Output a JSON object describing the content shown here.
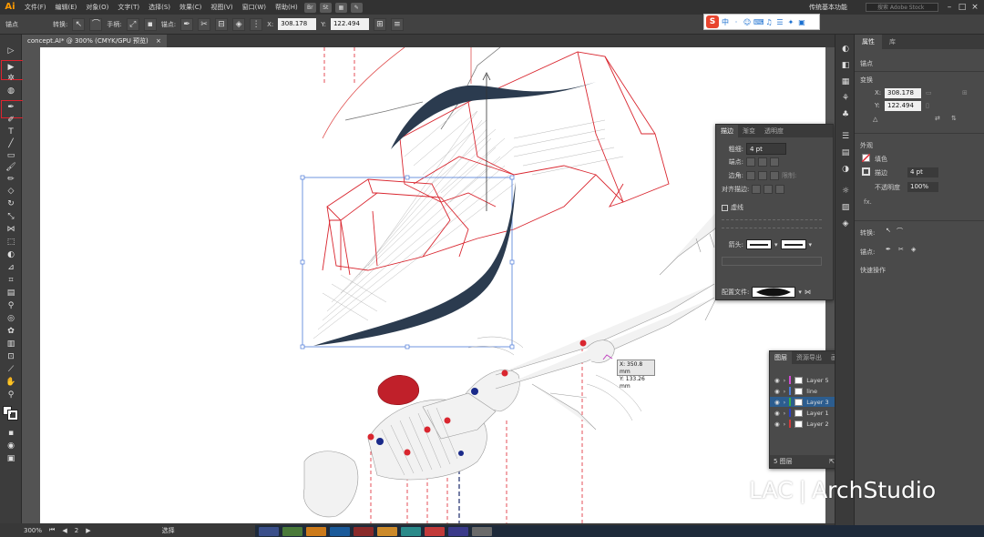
{
  "app": {
    "logo": "Ai",
    "workspace": "传统基本功能",
    "search_placeholder": "搜索 Adobe Stock"
  },
  "menu": [
    "文件(F)",
    "编辑(E)",
    "对象(O)",
    "文字(T)",
    "选择(S)",
    "效果(C)",
    "视图(V)",
    "窗口(W)",
    "帮助(H)"
  ],
  "bridge_icons": [
    "Br",
    "St"
  ],
  "control": {
    "selection_label": "锚点",
    "convert_label": "转换:",
    "handles_label": "手柄:",
    "anchors_label": "锚点:",
    "x_label": "X:",
    "x_value": "308.178",
    "y_label": "Y:",
    "y_value": "122.494"
  },
  "ime": {
    "logo": "S",
    "items": [
      "中",
      "·",
      "☺",
      "⌨",
      "♫",
      "☰",
      "✦",
      "▣"
    ]
  },
  "document": {
    "tab_title": "concept.AI* @ 300% (CMYK/GPU 预览)",
    "close": "×"
  },
  "status": {
    "zoom": "300%",
    "artboard_nav": "2",
    "tool": "选择"
  },
  "properties": {
    "tabs": [
      "属性",
      "库"
    ],
    "section_anchor": "锚点",
    "section_transform": "变换",
    "x_label": "X:",
    "x_value": "308.178",
    "y_label": "Y:",
    "y_value": "122.494",
    "angle_label": "△",
    "appearance": "外观",
    "fill": "填色",
    "stroke": "描边",
    "stroke_value": "4 pt",
    "opacity": "不透明度",
    "opacity_value": "100%",
    "convert": "转换:",
    "anchor_label": "锚点:",
    "quick_actions": "快速操作"
  },
  "stroke_panel": {
    "tabs": [
      "描边",
      "渐变",
      "透明度"
    ],
    "weight_label": "粗细:",
    "weight_value": "4 pt",
    "cap_label": "端点:",
    "corner_label": "边角:",
    "limit_label": "限制:",
    "align_label": "对齐描边:",
    "dashed_label": "虚线",
    "arrow_label": "箭头:",
    "profile_label": "配置文件:"
  },
  "layers_panel": {
    "tabs": [
      "图层",
      "资源导出",
      "画板"
    ],
    "layers": [
      {
        "name": "Layer 5",
        "color": "#d04ad0",
        "selected": false
      },
      {
        "name": "line",
        "color": "#4a7ad8",
        "selected": false
      },
      {
        "name": "Layer 3",
        "color": "#3ab040",
        "selected": true
      },
      {
        "name": "Layer 1",
        "color": "#2a40c8",
        "selected": false
      },
      {
        "name": "Layer 2",
        "color": "#d03a3a",
        "selected": false
      }
    ],
    "footer": "5 图层"
  },
  "tooltip": {
    "x": "X: 350.8 mm",
    "y": "Y: 133.26 mm"
  },
  "watermark": {
    "brand": "LAC",
    "separator": "|",
    "name": "ArchStudio"
  },
  "colors": {
    "accent_red": "#e0232e",
    "selection_blue": "#4c7ad8",
    "path_dark": "#2b3b4f"
  }
}
